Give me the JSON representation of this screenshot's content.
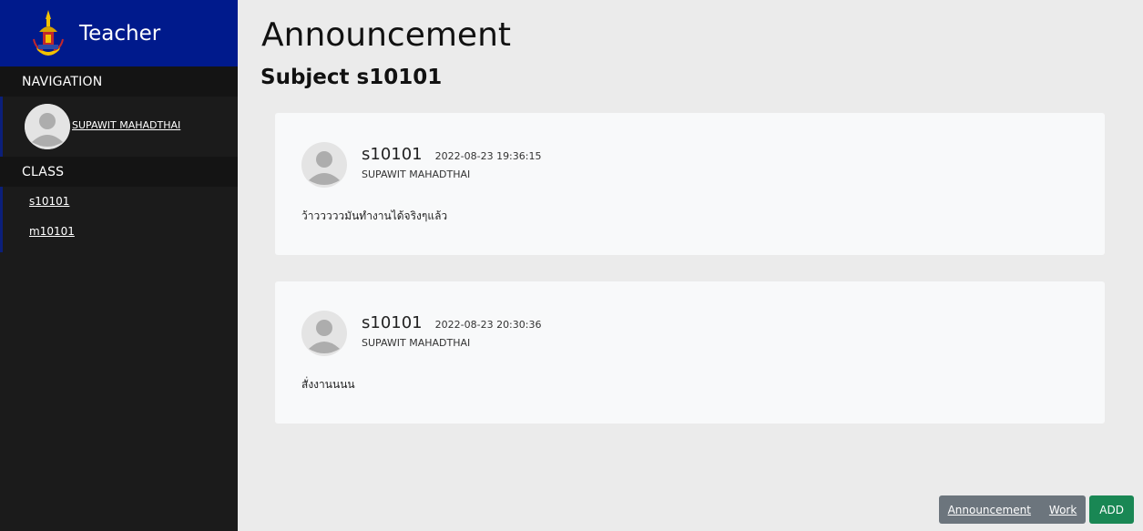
{
  "sidebar": {
    "brand_title": "Teacher",
    "navigation_header": "NAVIGATION",
    "user_name": "SUPAWIT MAHADTHAI",
    "class_header": "CLASS",
    "classes": [
      "s10101",
      "m10101"
    ]
  },
  "main": {
    "page_title": "Announcement",
    "subject_title": "Subject s10101",
    "posts": [
      {
        "code": "s10101",
        "timestamp": "2022-08-23 19:36:15",
        "author": "SUPAWIT MAHADTHAI",
        "body": "ว้าวววววมันทำงานได้จริงๆแล้ว"
      },
      {
        "code": "s10101",
        "timestamp": "2022-08-23 20:30:36",
        "author": "SUPAWIT MAHADTHAI",
        "body": "สั่งงานนนน"
      }
    ]
  },
  "footer": {
    "announcement_link": "Announcement",
    "work_link": "Work",
    "add_button": "ADD"
  },
  "colors": {
    "brand_bar": "#001a8c",
    "sidebar_bg": "#1b1b1b",
    "add_green": "#198754",
    "link_group_gray": "#6c757d"
  },
  "icons": [
    "school-logo-icon",
    "user-avatar-icon"
  ]
}
